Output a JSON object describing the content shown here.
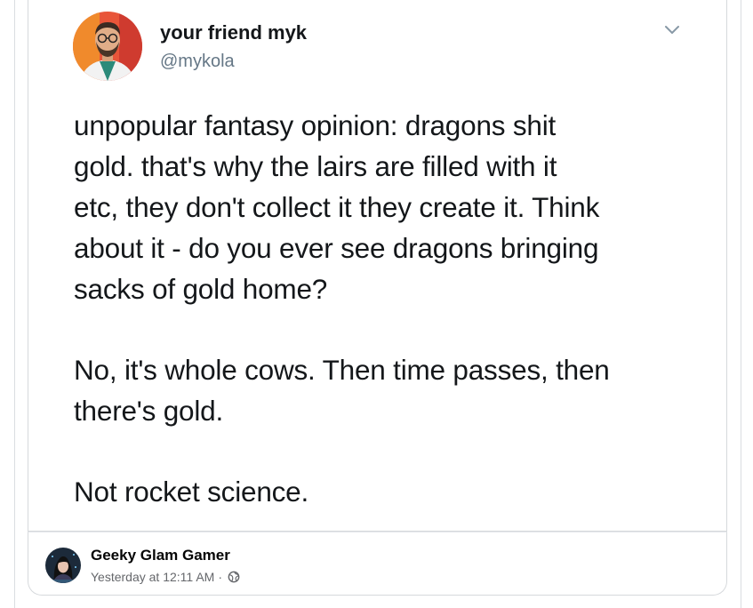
{
  "tweet": {
    "display_name": "your friend myk",
    "handle": "@mykola",
    "paragraphs": [
      "unpopular fantasy opinion: dragons shit\ngold. that's why the lairs are filled with it\netc, they don't collect it they create it. Think\nabout it - do you ever see dragons bringing\nsacks of gold home?",
      "No, it's whole cows. Then time passes, then\nthere's gold.",
      "Not rocket science."
    ],
    "menu_icon": "chevron-down-icon"
  },
  "facebook_post": {
    "page_name": "Geeky Glam Gamer",
    "timestamp": "Yesterday at 12:11 AM",
    "separator": "·",
    "audience_icon": "globe-icon"
  },
  "colors": {
    "text_primary": "#14171a",
    "text_secondary": "#657786",
    "fb_secondary": "#65676b",
    "border": "#d6d9dc"
  }
}
